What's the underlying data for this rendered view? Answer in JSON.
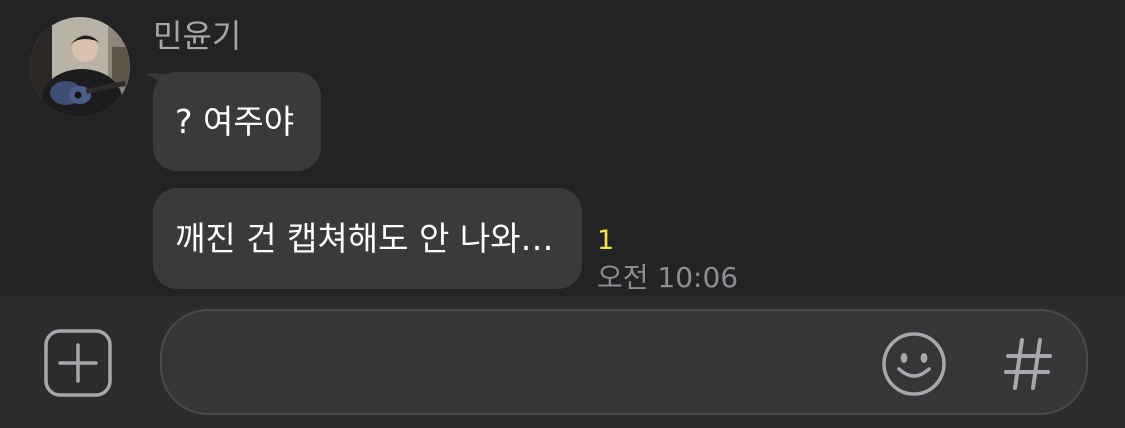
{
  "message": {
    "sender_name": "민윤기",
    "bubbles": [
      {
        "text": "? 여주야"
      },
      {
        "text": "깨진 건 캡쳐해도 안 나와…"
      }
    ],
    "read_count": "1",
    "timestamp": "오전 10:06"
  },
  "input_bar": {
    "icons": {
      "add": "plus-square-icon",
      "emoji": "smiley-icon",
      "hashtag": "hashtag-icon"
    }
  },
  "colors": {
    "background": "#232325",
    "input_bar": "#2c2c2e",
    "bubble": "#3a3a3c",
    "unread_count": "#f5e14a",
    "muted_text": "#8e8e92"
  }
}
